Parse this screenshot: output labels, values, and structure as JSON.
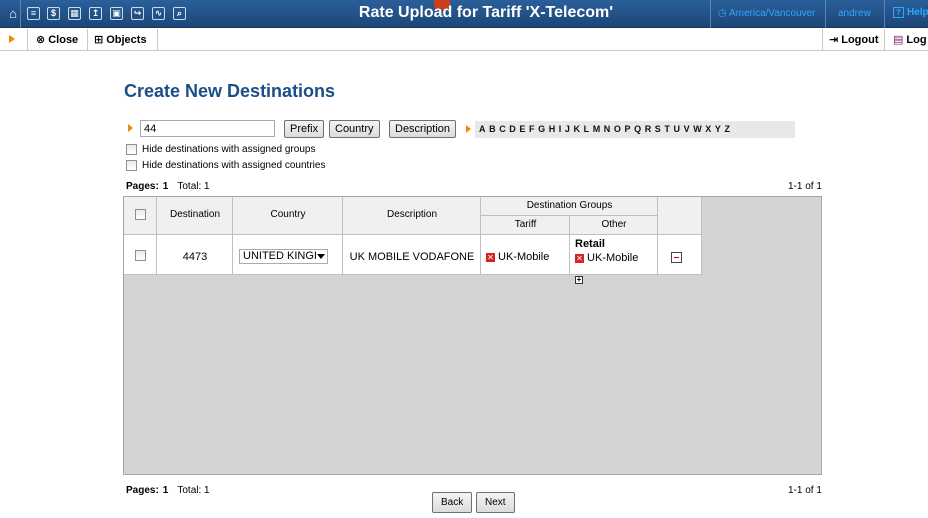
{
  "window": {
    "title": "Rate Upload for Tariff 'X-Telecom'",
    "timezone": "America/Vancouver",
    "user": "andrew",
    "help_label": "Help",
    "nav_icons": [
      "home-icon",
      "list-icon",
      "dollar-icon",
      "grid-icon",
      "upload-icon",
      "image-icon",
      "share-icon",
      "chart-icon",
      "search-icon"
    ]
  },
  "toolbar": {
    "close_label": "Close",
    "objects_label": "Objects",
    "logout_label": "Logout",
    "log_label": "Log"
  },
  "page": {
    "title": "Create New Destinations"
  },
  "filter": {
    "search_value": "44",
    "prefix_label": "Prefix",
    "country_label": "Country",
    "description_label": "Description",
    "letters": [
      "A",
      "B",
      "C",
      "D",
      "E",
      "F",
      "G",
      "H",
      "I",
      "J",
      "K",
      "L",
      "M",
      "N",
      "O",
      "P",
      "Q",
      "R",
      "S",
      "T",
      "U",
      "V",
      "W",
      "X",
      "Y",
      "Z"
    ],
    "hide_groups_label": "Hide destinations with assigned groups",
    "hide_countries_label": "Hide destinations with assigned countries"
  },
  "pagination": {
    "pages_label": "Pages:",
    "page_number": "1",
    "total_label": "Total: 1",
    "range_label": "1-1 of 1"
  },
  "table": {
    "headers": {
      "destination": "Destination",
      "country": "Country",
      "description": "Description",
      "destination_groups": "Destination Groups",
      "tariff": "Tariff",
      "other": "Other"
    },
    "rows": [
      {
        "destination": "4473",
        "country": "UNITED KINGI",
        "description": "UK MOBILE VODAFONE",
        "tariff_group": "UK-Mobile",
        "other_heading": "Retail",
        "other_group": "UK-Mobile"
      }
    ]
  },
  "buttons": {
    "back_label": "Back",
    "next_label": "Next"
  },
  "colors": {
    "topbar": "#2a5f9a",
    "title_blue": "#1b4f86",
    "accent_orange": "#f08a00",
    "link_blue": "#2ea6ff",
    "remove_red": "#d92121"
  }
}
